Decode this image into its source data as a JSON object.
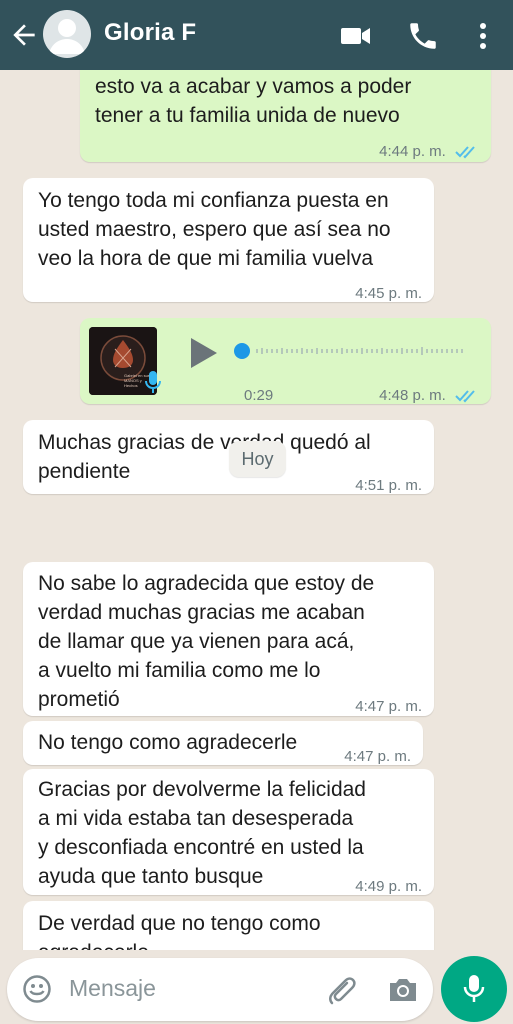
{
  "header": {
    "contact_name": "Gloria F",
    "icons": [
      "back-arrow-icon",
      "avatar",
      "video-call-icon",
      "phone-icon",
      "more-options-icon"
    ]
  },
  "messages": [
    {
      "direction": "outgoing",
      "text": "esto va a acabar y vamos a poder\ntener a tu familia unida de nuevo",
      "time": "4:44 p. m.",
      "read": true
    },
    {
      "direction": "incoming",
      "text": "Yo tengo toda mi confianza puesta en\nusted maestro, espero que así sea no\nveo la hora de que mi familia vuelva",
      "time": "4:45 p. m."
    },
    {
      "direction": "outgoing",
      "type": "voice",
      "duration": "0:29",
      "time": "4:48 p. m.",
      "read": true,
      "thumb_caption": "Gabriel en sus\nMANOS y Hechos"
    },
    {
      "direction": "incoming",
      "text": "Muchas gracias de verdad quedó al\npendiente",
      "time": "4:51 p. m."
    },
    {
      "direction": "incoming",
      "text": "No sabe lo agradecida que estoy de\nverdad muchas gracias me acaban\nde llamar que ya vienen para acá,\na vuelto  mi familia como me lo\nprometió",
      "time": "4:47 p. m."
    },
    {
      "direction": "incoming",
      "text": "No tengo como agradecerle",
      "time": "4:47 p. m."
    },
    {
      "direction": "incoming",
      "text": "Gracias por devolverme la felicidad\na mi vida estaba tan desesperada\ny desconfiada encontré en usted la\nayuda que tanto busque",
      "time": "4:49 p. m."
    },
    {
      "direction": "incoming",
      "text": "De verdad que no tengo como\nagradecerle",
      "time": ""
    }
  ],
  "day_divider": "Hoy",
  "composer": {
    "placeholder": "Mensaje",
    "icons": [
      "emoji-icon",
      "attach-icon",
      "camera-icon",
      "mic-icon"
    ]
  },
  "colors": {
    "header": "#32525b",
    "outgoing_bubble": "#dbf7c5",
    "incoming_bubble": "#ffffff",
    "read_tick": "#53bdeb",
    "accent": "#00a884"
  }
}
